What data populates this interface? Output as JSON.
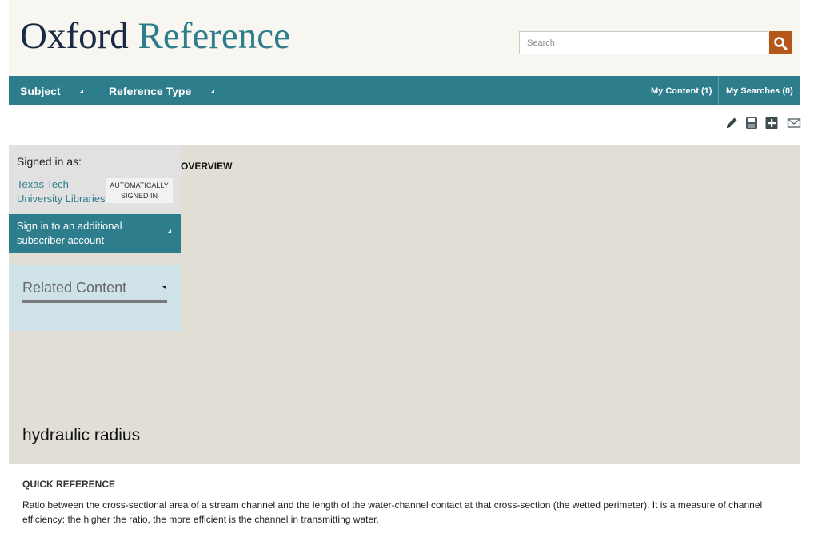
{
  "header": {
    "logo_part1": "Oxford",
    "logo_part2": "Reference",
    "search_placeholder": "Search",
    "search_icon": "magnifier-icon"
  },
  "nav": {
    "subject": "Subject",
    "reference_type": "Reference Type",
    "my_content": "My Content (1)",
    "my_searches": "My Searches (0)"
  },
  "tools": [
    "pencil-icon",
    "save-icon",
    "plus-icon",
    "email-icon"
  ],
  "sidebar": {
    "signed_in_label": "Signed in as:",
    "institution": "Texas Tech University Libraries",
    "auto_badge": "AUTOMATICALLY SIGNED IN",
    "subscriber_button": "Sign in to an additional subscriber account",
    "related_content": "Related Content"
  },
  "content": {
    "overview_label": "OVERVIEW",
    "entry_title": "hydraulic radius",
    "quick_reference_heading": "QUICK REFERENCE",
    "quick_reference_text": "Ratio between the cross-sectional area of a stream channel and the length of the water-channel contact at that cross-section (the wetted perimeter). It is a measure of channel efficiency: the higher the ratio, the more efficient is the channel in transmitting water."
  },
  "colors": {
    "brand_teal": "#2e7d8c",
    "brand_navy": "#1a2a44",
    "search_orange": "#b5561a",
    "main_bg": "#e1dfd5",
    "related_bg": "#cfe2e8"
  }
}
